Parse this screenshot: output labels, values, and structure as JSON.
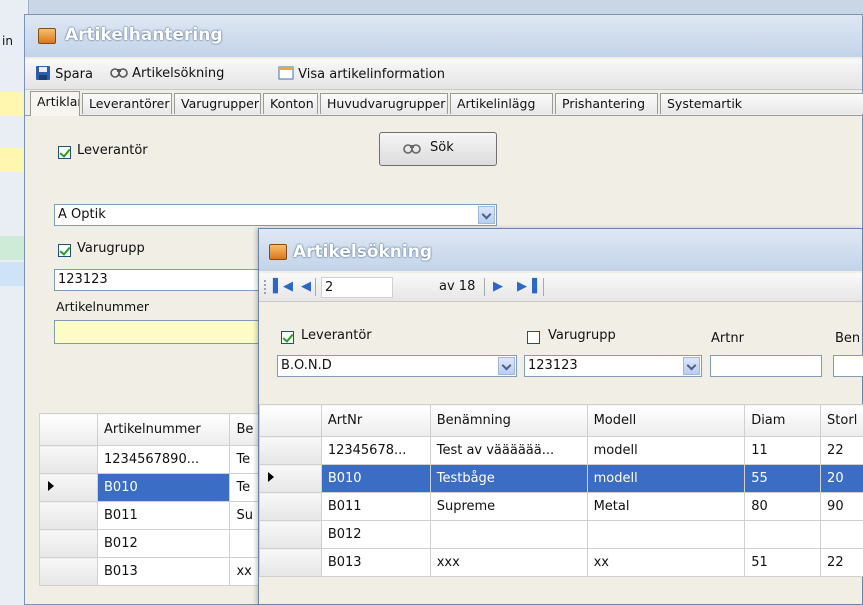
{
  "main": {
    "title": "Artikelhantering",
    "toolbar": {
      "save": "Spara",
      "search": "Artikelsökning",
      "info": "Visa artikelinformation"
    },
    "tabs": [
      "Artiklar",
      "Leverantörer",
      "Varugrupper",
      "Konton",
      "Huvudvarugrupper",
      "Artikelinlägg",
      "Prishantering",
      "Systemartik"
    ],
    "form": {
      "supplier_label": "Leverantör",
      "supplier_value": "A Optik",
      "search_button": "Sök",
      "group_label": "Varugrupp",
      "group_value": "123123",
      "artnr_label": "Artikelnummer",
      "artnr_value": ""
    },
    "grid": {
      "headers": [
        "Artikelnummer",
        "Be"
      ],
      "rows": [
        {
          "c0": "1234567890...",
          "c1": "Te"
        },
        {
          "c0": "B010",
          "c1": "Te"
        },
        {
          "c0": "B011",
          "c1": "Su"
        },
        {
          "c0": "B012",
          "c1": ""
        },
        {
          "c0": "B013",
          "c1": "xx"
        }
      ]
    }
  },
  "popup": {
    "title": "Artikelsökning",
    "nav": {
      "position": "2",
      "count": "av 18"
    },
    "filters": {
      "supplier_label": "Leverantör",
      "supplier_value": "B.O.N.D",
      "group_label": "Varugrupp",
      "group_value": "123123",
      "artnr_label": "Artnr",
      "artnr_value": "",
      "name_label": "Ben",
      "name_value": ""
    },
    "grid": {
      "headers": [
        "ArtNr",
        "Benämning",
        "Modell",
        "Diam",
        "Storl"
      ],
      "rows": [
        [
          "12345678...",
          "Test av vääääää...",
          "modell",
          "11",
          "22"
        ],
        [
          "B010",
          "Testbåge",
          "modell",
          "55",
          "20"
        ],
        [
          "B011",
          "Supreme",
          "Metal",
          "80",
          "90"
        ],
        [
          "B012",
          "",
          "",
          "",
          ""
        ],
        [
          "B013",
          "xxx",
          "xx",
          "51",
          "22"
        ]
      ]
    }
  },
  "background": {
    "left_edge_text": "in"
  }
}
